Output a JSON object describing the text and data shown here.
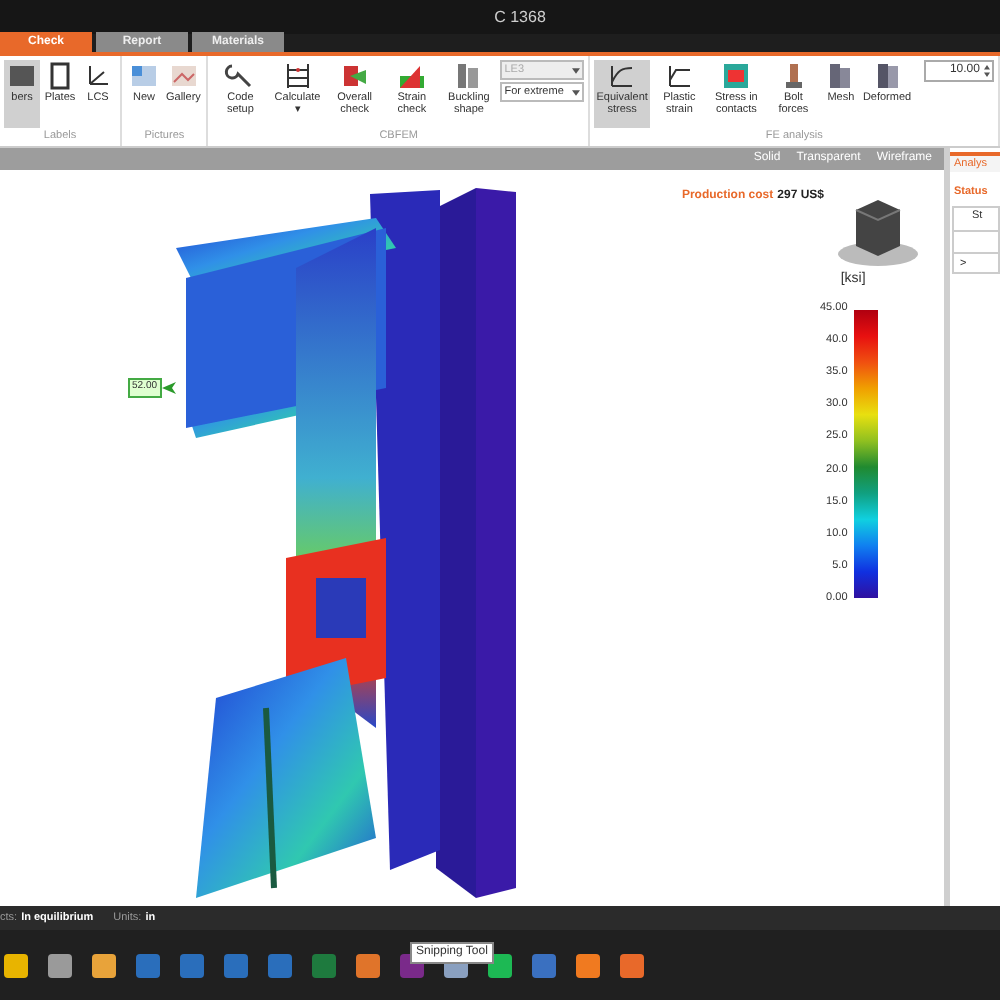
{
  "window": {
    "title": "C 1368"
  },
  "tabs": [
    {
      "label": "Check",
      "selected": true
    },
    {
      "label": "Report",
      "selected": false
    },
    {
      "label": "Materials",
      "selected": false
    }
  ],
  "ribbon": [
    {
      "caption": "Labels",
      "items": [
        {
          "label": "bers",
          "selected": true
        },
        {
          "label": "Plates",
          "selected": false
        },
        {
          "label": "LCS",
          "selected": false
        }
      ]
    },
    {
      "caption": "Pictures",
      "items": [
        {
          "label": "New",
          "selected": false
        },
        {
          "label": "Gallery",
          "selected": false
        }
      ]
    },
    {
      "caption": "CBFEM",
      "items": [
        {
          "label": "Code setup",
          "selected": false
        },
        {
          "label": "Calculate ▾",
          "selected": false
        },
        {
          "label": "Overall check",
          "selected": false
        },
        {
          "label": "Strain check",
          "selected": false
        },
        {
          "label": "Buckling shape",
          "selected": false
        }
      ],
      "dropdowns": [
        {
          "value": "LE3",
          "disabled": true
        },
        {
          "value": "For extreme",
          "disabled": false
        }
      ]
    },
    {
      "caption": "FE analysis",
      "items": [
        {
          "label": "Equivalent stress",
          "selected": true
        },
        {
          "label": "Plastic strain",
          "selected": false
        },
        {
          "label": "Stress in contacts",
          "selected": false
        },
        {
          "label": "Bolt forces",
          "selected": false
        },
        {
          "label": "Mesh",
          "selected": false
        },
        {
          "label": "Deformed",
          "selected": false
        }
      ],
      "spinbox": {
        "value": "10.00"
      }
    }
  ],
  "view_modes": [
    "Solid",
    "Transparent",
    "Wireframe"
  ],
  "viewport": {
    "cost_label": "Production cost",
    "cost_value": "297 US$",
    "load_label": "52.00",
    "legend": {
      "unit": "[ksi]",
      "ticks": [
        "45.00",
        "40.0",
        "35.0",
        "30.0",
        "25.0",
        "20.0",
        "15.0",
        "10.0",
        "5.0",
        "0.00"
      ]
    }
  },
  "side_panel": {
    "tab": "Analys",
    "heading": "Status",
    "column_1": "St",
    "row_marker": ">"
  },
  "status_bar": [
    {
      "label": "cts:",
      "value": "In equilibrium"
    },
    {
      "label": "Units:",
      "value": "in"
    }
  ],
  "taskbar": {
    "tooltip": "Snipping Tool",
    "apps": [
      {
        "color": "#e8b400"
      },
      {
        "color": "#9a9a9a"
      },
      {
        "color": "#e8a33a"
      },
      {
        "color": "#2a6ebb"
      },
      {
        "color": "#2a6ebb"
      },
      {
        "color": "#2a6ebb"
      },
      {
        "color": "#2a6ebb"
      },
      {
        "color": "#1e7a3e"
      },
      {
        "color": "#e0742a"
      },
      {
        "color": "#7a2a8a"
      },
      {
        "color": "#8aa0c0"
      },
      {
        "color": "#1db954"
      },
      {
        "color": "#3a70c0"
      },
      {
        "color": "#f07a20"
      },
      {
        "color": "#e8692a"
      }
    ]
  }
}
